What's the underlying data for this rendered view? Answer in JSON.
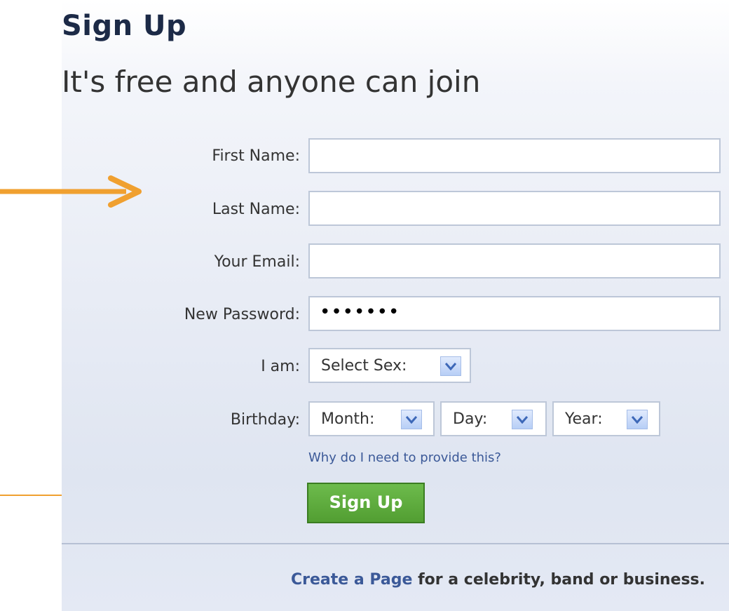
{
  "header": {
    "title": "Sign Up",
    "subtitle": "It's free and anyone can join"
  },
  "form": {
    "first_name_label": "First Name:",
    "last_name_label": "Last Name:",
    "email_label": "Your Email:",
    "password_label": "New Password:",
    "password_value": "•••••••",
    "sex_label": "I am:",
    "sex_select": "Select Sex:",
    "birthday_label": "Birthday:",
    "month_select": "Month:",
    "day_select": "Day:",
    "year_select": "Year:",
    "why_link": "Why do I need to provide this?",
    "signup_button": "Sign Up"
  },
  "footer": {
    "create_page_link": "Create a Page",
    "create_page_text": " for a celebrity, band or business."
  },
  "colors": {
    "accent_link": "#3b5998",
    "button_green": "#5ba83b",
    "annotation_orange": "#f0a030"
  }
}
